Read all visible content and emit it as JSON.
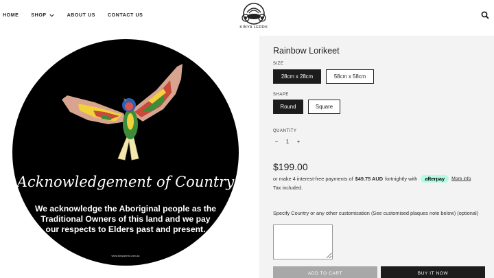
{
  "nav": {
    "home": "HOME",
    "shop": "SHOP",
    "about": "ABOUT US",
    "contact": "CONTACT US"
  },
  "logo": {
    "text": "KINYA LERRK"
  },
  "plaque": {
    "title": "Acknowledgement of Country",
    "body": "We acknowledge the Aboriginal people as the Traditional Owners of this land and we pay our respects to Elders past and present.",
    "url": "www.kinyalerrk.com.au"
  },
  "product": {
    "title": "Rainbow Lorikeet",
    "size_label": "SIZE",
    "sizes": [
      "28cm x 28cm",
      "58cm x 58cm"
    ],
    "shape_label": "SHAPE",
    "shapes": [
      "Round",
      "Square"
    ],
    "quantity_label": "QUANTITY",
    "quantity_minus": "−",
    "quantity_value": "1",
    "quantity_plus": "+",
    "price": "$199.00",
    "installment_prefix": "or make 4 interest-free payments of",
    "installment_amount": "$49.75 AUD",
    "installment_suffix": "fortnightly with",
    "afterpay": "afterpay",
    "more_info": "More info",
    "tax_note": "Tax included.",
    "custom_label": "Specify Country or any other customisation (See customised plaques note below) (optional)",
    "add_to_cart": "ADD TO CART",
    "buy_now": "BUY IT NOW"
  },
  "colors": {
    "dark_button": "#1c1c1c",
    "panel_bg": "#f3f3f3",
    "afterpay_mint": "#b2fce4",
    "add_cart_bg": "#a8a8a8"
  },
  "icons": [
    "chevron-down-icon",
    "search-icon",
    "lorikeet-artwork"
  ]
}
